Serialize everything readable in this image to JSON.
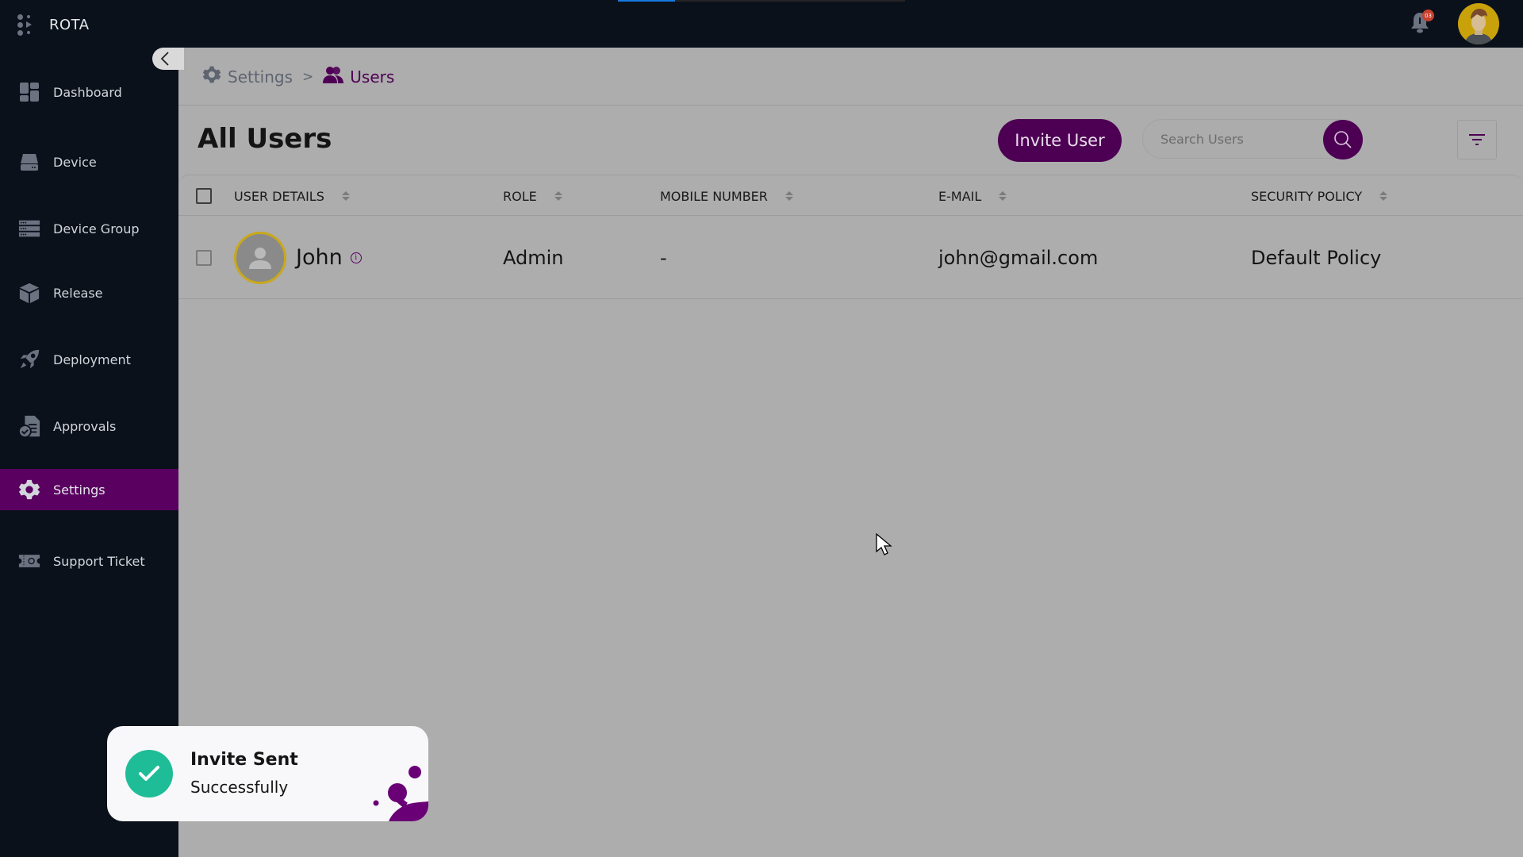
{
  "app": {
    "name": "ROTA"
  },
  "topbar": {
    "loading_progress_percent": 20,
    "notifications_count": "03"
  },
  "sidebar": {
    "items": [
      {
        "label": "Dashboard",
        "icon": "dashboard-icon",
        "active": false
      },
      {
        "label": "Device",
        "icon": "device-icon",
        "active": false
      },
      {
        "label": "Device Group",
        "icon": "device-group-icon",
        "active": false
      },
      {
        "label": "Release",
        "icon": "release-box-icon",
        "active": false
      },
      {
        "label": "Deployment",
        "icon": "rocket-icon",
        "active": false
      },
      {
        "label": "Approvals",
        "icon": "approvals-icon",
        "active": false
      },
      {
        "label": "Settings",
        "icon": "gear-icon",
        "active": true
      },
      {
        "label": "Support Ticket",
        "icon": "ticket-icon",
        "active": false
      }
    ]
  },
  "breadcrumb": {
    "items": [
      {
        "label": "Settings",
        "icon": "gear-icon"
      },
      {
        "label": "Users",
        "icon": "users-icon"
      }
    ],
    "separator": ">"
  },
  "page": {
    "title": "All Users",
    "invite_button": "Invite User",
    "search_placeholder": "Search Users",
    "search_value": ""
  },
  "table": {
    "columns": [
      "USER DETAILS",
      "ROLE",
      "MOBILE NUMBER",
      "E-MAIL",
      "SECURITY POLICY"
    ],
    "rows": [
      {
        "name": "John",
        "role": "Admin",
        "mobile": "-",
        "email": "john@gmail.com",
        "security_policy": "Default Policy",
        "checked": false
      }
    ]
  },
  "toast": {
    "title": "Invite Sent",
    "message": "Successfully",
    "status": "success"
  },
  "colors": {
    "brand_purple": "#4d0053",
    "active_nav": "#5a0060",
    "success_green": "#1ebd98",
    "sidebar_bg": "#0b111b",
    "badge_red": "#c8402f",
    "progress_blue": "#1679e0"
  }
}
